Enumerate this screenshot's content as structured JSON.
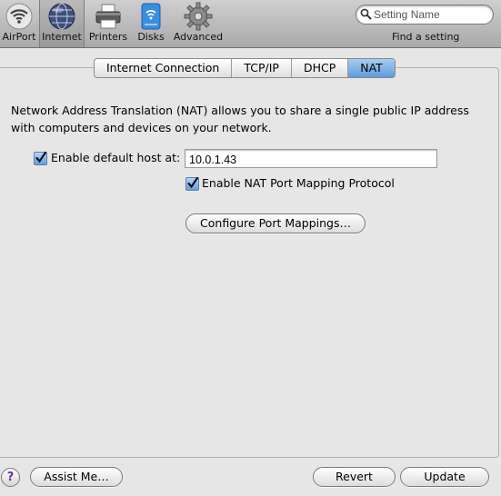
{
  "toolbar": {
    "items": [
      {
        "label": "AirPort",
        "icon": "airport-wifi-icon"
      },
      {
        "label": "Internet",
        "icon": "internet-globe-icon",
        "selected": true
      },
      {
        "label": "Printers",
        "icon": "printer-icon"
      },
      {
        "label": "Disks",
        "icon": "disk-icon"
      },
      {
        "label": "Advanced",
        "icon": "gear-icon"
      }
    ],
    "search_placeholder": "Setting Name",
    "find_label": "Find a setting"
  },
  "tabs": [
    {
      "label": "Internet Connection",
      "active": false
    },
    {
      "label": "TCP/IP",
      "active": false
    },
    {
      "label": "DHCP",
      "active": false
    },
    {
      "label": "NAT",
      "active": true
    }
  ],
  "nat": {
    "description": "Network Address Translation (NAT) allows you to share a single public IP address with computers and devices on your network.",
    "default_host": {
      "label": "Enable default host at:",
      "checked": true,
      "value": "10.0.1.43"
    },
    "port_mapping_protocol": {
      "label": "Enable NAT Port Mapping Protocol",
      "checked": true
    },
    "configure_button": "Configure Port Mappings…"
  },
  "footer": {
    "help_symbol": "?",
    "assist_button": "Assist Me…",
    "revert_button": "Revert",
    "update_button": "Update"
  },
  "colors": {
    "tab_active": "#6fa6e4",
    "checkbox_fill": "#5f9ee4",
    "window_bg": "#e6e6e6"
  }
}
